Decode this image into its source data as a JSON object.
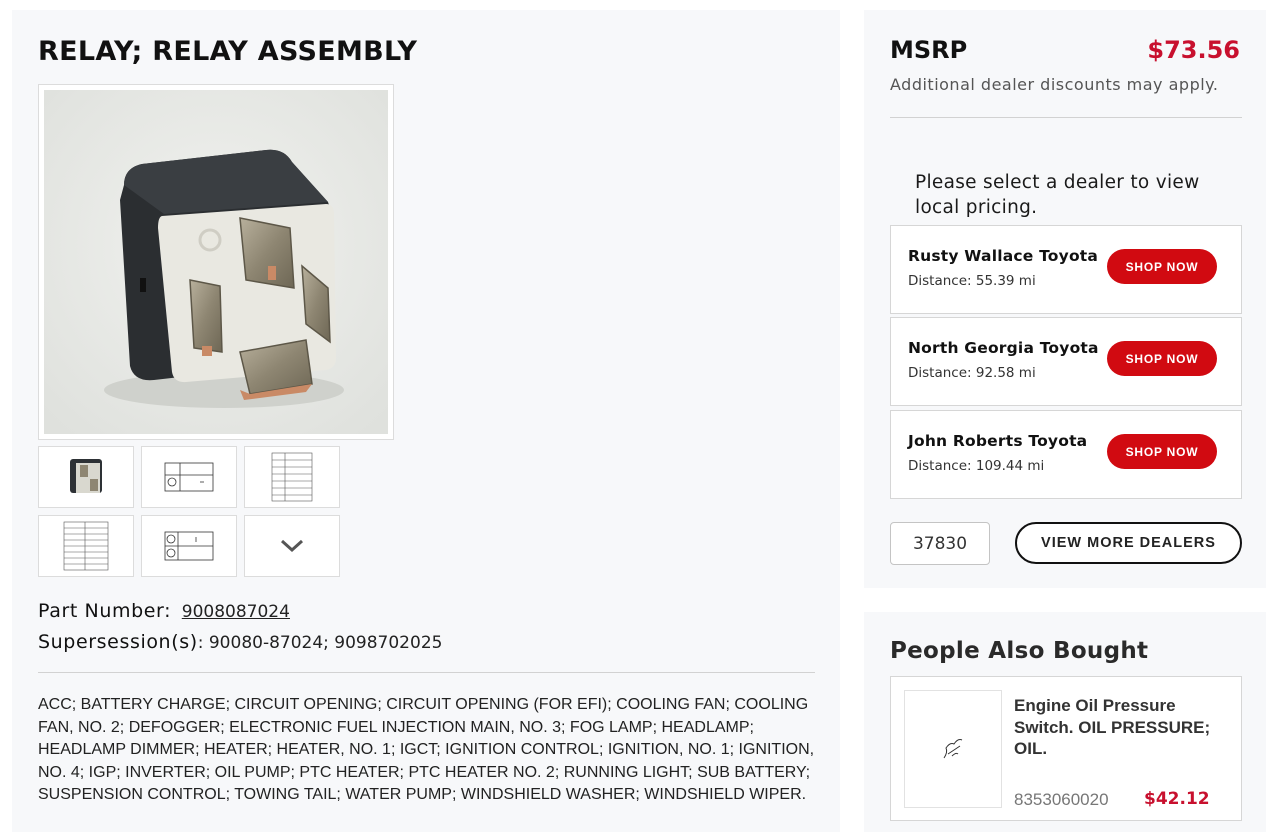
{
  "product": {
    "title": "RELAY; RELAY ASSEMBLY",
    "part_number_label": "Part Number:",
    "part_number": "9008087024",
    "supersession_label": "Supersession(s)",
    "supersessions": ": 90080-87024; 9098702025",
    "applications": "ACC; BATTERY CHARGE; CIRCUIT OPENING; CIRCUIT OPENING (FOR EFI); COOLING FAN; COOLING FAN, NO. 2; DEFOGGER; ELECTRONIC FUEL INJECTION MAIN, NO. 3; FOG LAMP; HEADLAMP; HEADLAMP DIMMER; HEATER; HEATER, NO. 1; IGCT; IGNITION CONTROL; IGNITION, NO. 1; IGNITION, NO. 4; IGP; INVERTER; OIL PUMP; PTC HEATER; PTC HEATER NO. 2; RUNNING LIGHT; SUB BATTERY; SUSPENSION CONTROL; TOWING TAIL; WATER PUMP; WINDSHIELD WASHER; WINDSHIELD WIPER."
  },
  "gallery": {
    "thumbnails": [
      "relay-photo-thumb",
      "pin-diagram-thumb",
      "spec-table-thumb",
      "spec-table-thumb-2",
      "circuit-diagram-thumb"
    ],
    "more_icon": "chevron-down-icon"
  },
  "pricing": {
    "msrp_label": "MSRP",
    "msrp_value": "$73.56",
    "discount_note": "Additional dealer discounts may apply.",
    "dealer_prompt": "Please select a dealer to view local pricing.",
    "accent_color": "#d10a11"
  },
  "dealers": [
    {
      "name": "Rusty Wallace Toyota",
      "distance": "Distance: 55.39 mi",
      "button": "SHOP NOW"
    },
    {
      "name": "North Georgia Toyota",
      "distance": "Distance: 92.58 mi",
      "button": "SHOP NOW"
    },
    {
      "name": "John Roberts Toyota",
      "distance": "Distance: 109.44 mi",
      "button": "SHOP NOW"
    }
  ],
  "dealer_search": {
    "zip_value": "37830",
    "view_more_label": "VIEW MORE DEALERS"
  },
  "also_bought": {
    "title": "People Also Bought",
    "items": [
      {
        "name": "Engine Oil Pressure Switch. OIL PRESSURE; OIL.",
        "part_number": "8353060020",
        "price": "$42.12"
      }
    ]
  }
}
